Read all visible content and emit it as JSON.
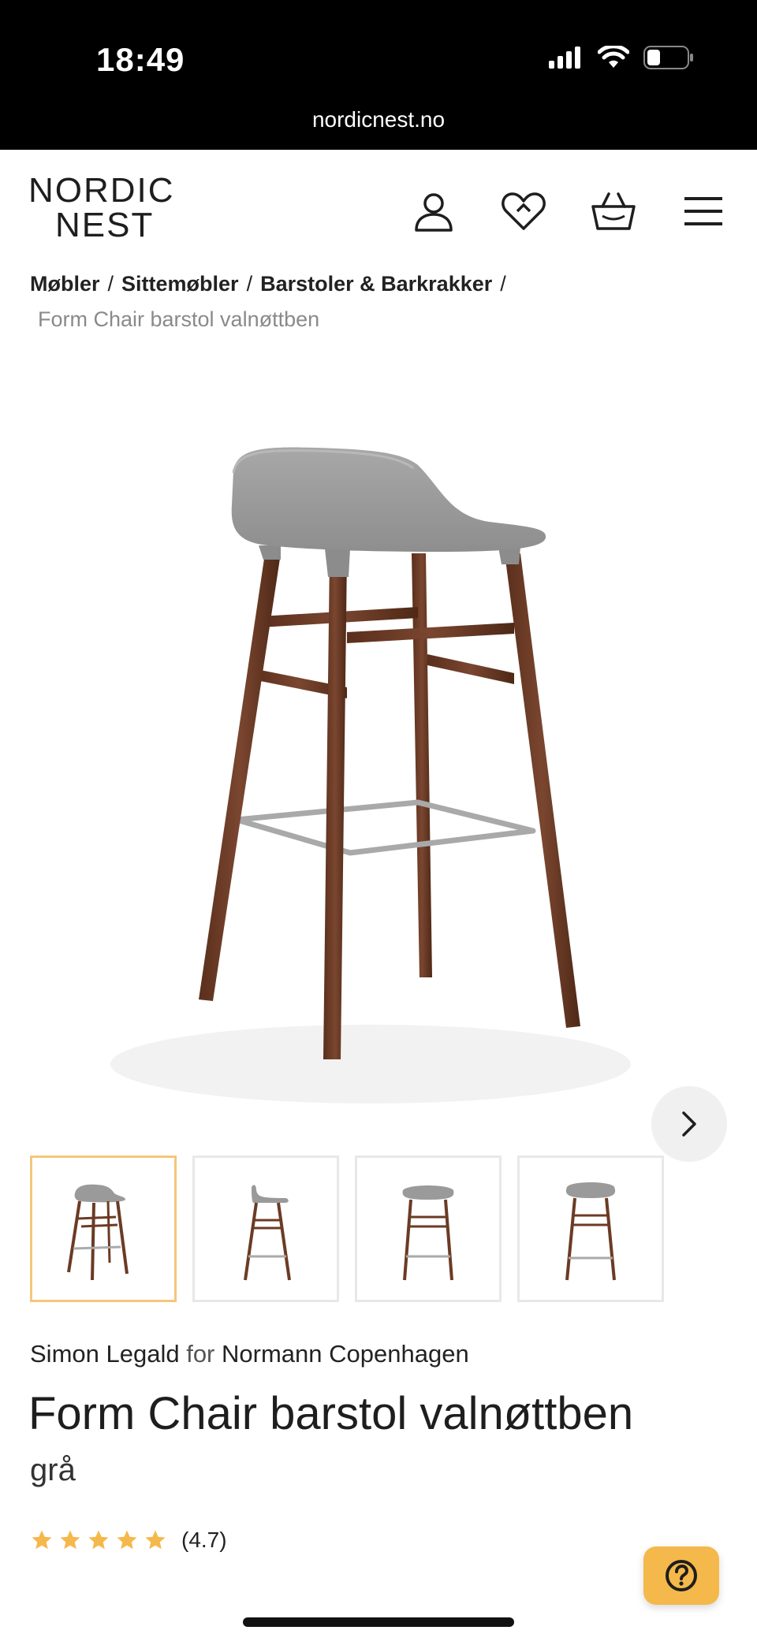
{
  "status_bar": {
    "time": "18:49",
    "url": "nordicnest.no"
  },
  "header": {
    "logo_line1": "NORDIC",
    "logo_line2": "NEST",
    "icons": [
      "user-icon",
      "heart-icon",
      "basket-icon",
      "menu-icon"
    ]
  },
  "breadcrumb": {
    "items": [
      "Møbler",
      "Sittemøbler",
      "Barstoler & Barkrakker"
    ],
    "separator": "/",
    "current": "Form Chair barstol valnøttben"
  },
  "gallery": {
    "thumbnail_count": 4,
    "active_index": 0,
    "next_icon": "chevron-right-icon"
  },
  "product": {
    "designer": "Simon Legald",
    "for_word": "for",
    "brand": "Normann Copenhagen",
    "title": "Form Chair barstol valnøttben",
    "variant": "grå",
    "rating": 4.7,
    "rating_text": "(4.7)",
    "stars_max": 5
  },
  "help_button": {
    "icon": "question-icon"
  },
  "colors": {
    "accent": "#f5b84a",
    "thumb_active_border": "#f5c67a",
    "star": "#f5b84a",
    "seat_gray": "#9a9a9a",
    "walnut": "#6b3b24"
  }
}
